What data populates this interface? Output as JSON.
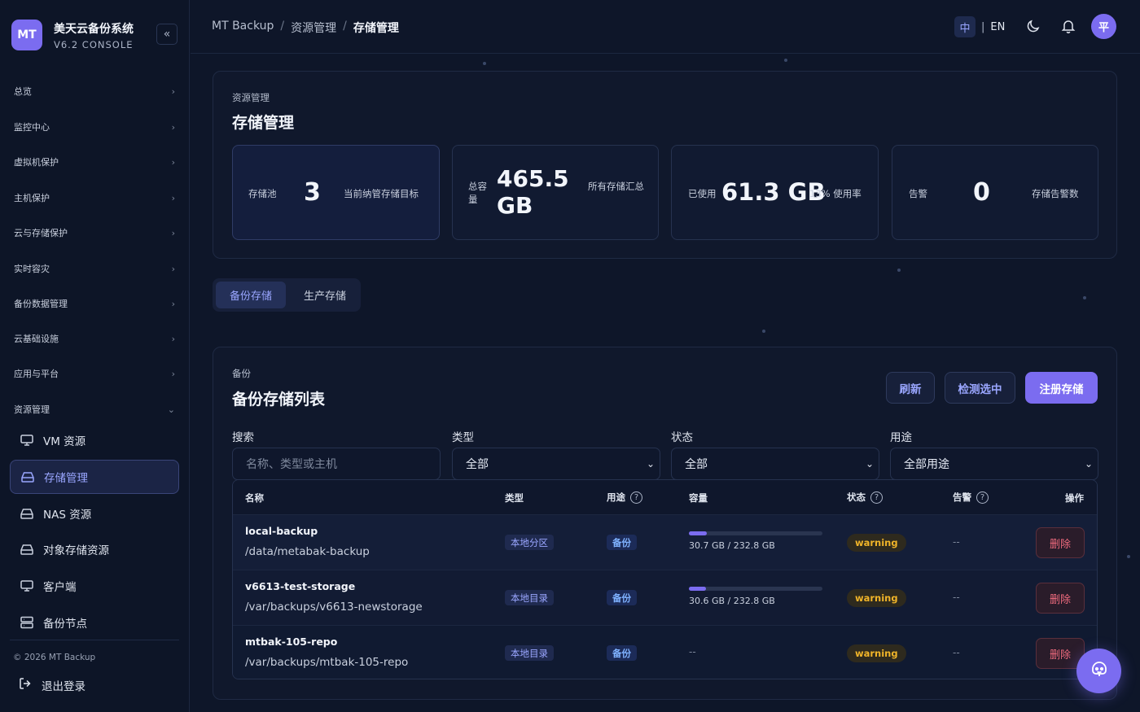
{
  "brand": {
    "logo": "MT",
    "name": "美天云备份系统",
    "version": "V6.2 CONSOLE"
  },
  "sidebar": {
    "groups": [
      "总览",
      "监控中心",
      "虚拟机保护",
      "主机保护",
      "云与存储保护",
      "实时容灾",
      "备份数据管理",
      "云基础设施",
      "应用与平台",
      "资源管理"
    ],
    "items": [
      {
        "label": "VM 资源",
        "icon": "monitor-icon"
      },
      {
        "label": "存储管理",
        "icon": "drive-icon",
        "active": true
      },
      {
        "label": "NAS 资源",
        "icon": "drive-icon"
      },
      {
        "label": "对象存储资源",
        "icon": "drive-icon"
      },
      {
        "label": "客户端",
        "icon": "monitor-icon"
      },
      {
        "label": "备份节点",
        "icon": "server-icon"
      }
    ],
    "copyright": "© 2026 MT Backup",
    "logout": "退出登录"
  },
  "header": {
    "breadcrumb": [
      "MT Backup",
      "资源管理",
      "存储管理"
    ],
    "lang_zh": "中",
    "lang_en": "EN",
    "avatar": "平"
  },
  "overview": {
    "section": "资源管理",
    "title": "存储管理",
    "stats": [
      {
        "label": "存储池",
        "value": "3",
        "desc": "当前纳管存储目标"
      },
      {
        "label": "总容量",
        "value": "465.5 GB",
        "desc": "所有存储汇总"
      },
      {
        "label": "已使用",
        "value": "61.3 GB",
        "desc": "13% 使用率"
      },
      {
        "label": "告警",
        "value": "0",
        "desc": "存储告警数"
      }
    ]
  },
  "tabs": [
    "备份存储",
    "生产存储"
  ],
  "list": {
    "section": "备份",
    "title": "备份存储列表",
    "buttons": {
      "refresh": "刷新",
      "check": "检测选中",
      "register": "注册存储"
    },
    "filters": {
      "search_label": "搜索",
      "search_placeholder": "名称、类型或主机",
      "type_label": "类型",
      "type_value": "全部",
      "status_label": "状态",
      "status_value": "全部",
      "usage_label": "用途",
      "usage_value": "全部用途"
    },
    "columns": [
      "名称",
      "类型",
      "用途",
      "容量",
      "状态",
      "告警",
      "操作"
    ],
    "rows": [
      {
        "name": "local-backup",
        "path": "/data/metabak-backup",
        "type": "本地分区",
        "usage": "备份",
        "capacity": "30.7 GB / 232.8 GB",
        "used_fraction": 0.132,
        "status": "warning",
        "alert": "--",
        "action": "删除"
      },
      {
        "name": "v6613-test-storage",
        "path": "/var/backups/v6613-newstorage",
        "type": "本地目录",
        "usage": "备份",
        "capacity": "30.6 GB / 232.8 GB",
        "used_fraction": 0.131,
        "status": "warning",
        "alert": "--",
        "action": "删除"
      },
      {
        "name": "mtbak-105-repo",
        "path": "/var/backups/mtbak-105-repo",
        "type": "本地目录",
        "usage": "备份",
        "capacity": "--",
        "status": "warning",
        "alert": "--",
        "action": "删除"
      }
    ]
  },
  "colors": {
    "accent": "#7b6cf0",
    "warning": "#f0b429",
    "danger": "#f06b7e",
    "background": "#0e1629"
  }
}
